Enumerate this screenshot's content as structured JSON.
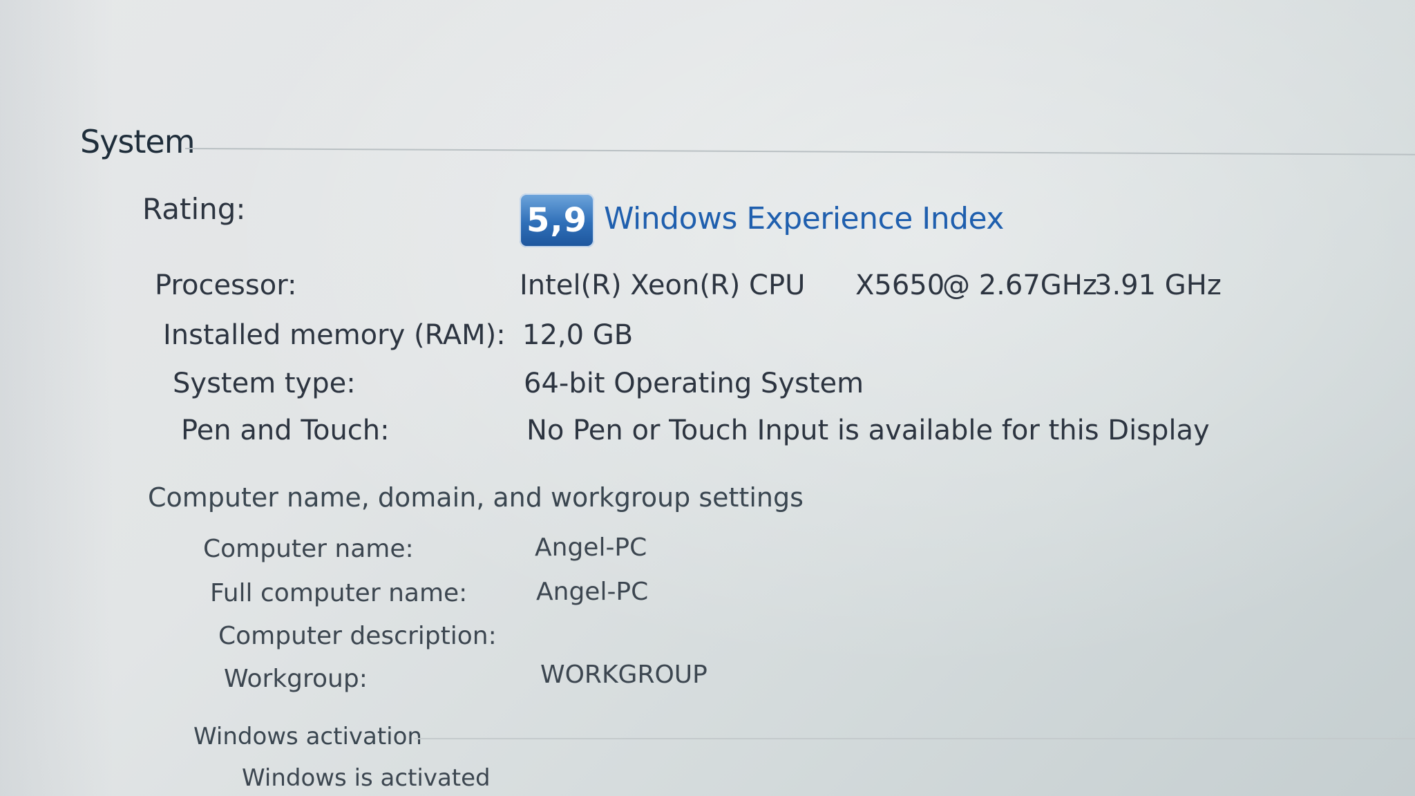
{
  "section": {
    "title": "System"
  },
  "rating": {
    "label": "Rating:",
    "score": "5,9",
    "link_text": "Windows Experience Index"
  },
  "processor": {
    "label": "Processor:",
    "name": "Intel(R) Xeon(R) CPU",
    "model": "X5650",
    "clock": "@ 2.67GHz",
    "speed": "3.91 GHz"
  },
  "memory": {
    "label": "Installed memory (RAM):",
    "value": "12,0 GB"
  },
  "system_type": {
    "label": "System type:",
    "value": "64-bit Operating System"
  },
  "pen_touch": {
    "label": "Pen and Touch:",
    "value": "No Pen or Touch Input is available for this Display"
  },
  "computer_settings": {
    "heading": "Computer name, domain, and workgroup settings",
    "computer_name_label": "Computer name:",
    "computer_name": "Angel-PC",
    "full_name_label": "Full computer name:",
    "full_name": "Angel-PC",
    "description_label": "Computer description:",
    "description": "",
    "workgroup_label": "Workgroup:",
    "workgroup": "WORKGROUP"
  },
  "activation": {
    "heading": "Windows activation",
    "status": "Windows is activated"
  },
  "colors": {
    "link": "#1f5fae",
    "badge": "#2f6fb8",
    "text": "#2c3440"
  }
}
